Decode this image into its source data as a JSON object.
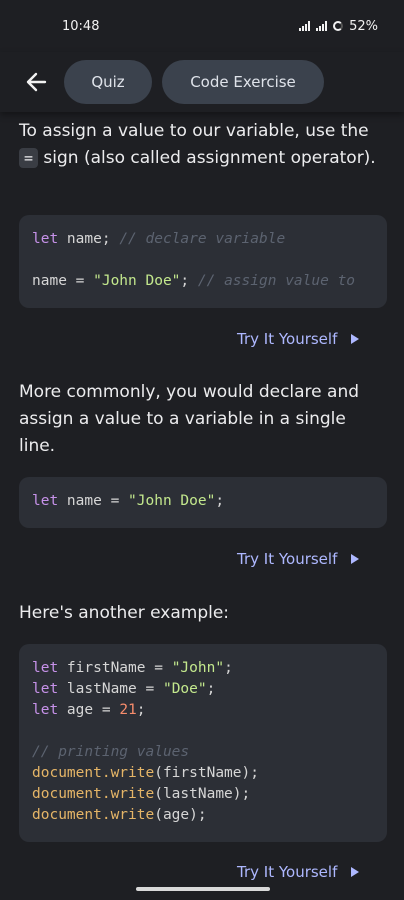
{
  "status_bar": {
    "time": "10:48",
    "battery": "52%"
  },
  "nav": {
    "quiz_label": "Quiz",
    "code_exercise_label": "Code Exercise"
  },
  "section1": {
    "text_before": "To assign a value to our variable, use the ",
    "inline_code": "=",
    "text_after": " sign (also called assignment operator)."
  },
  "code1": {
    "line1": {
      "kw": "let",
      "rest": " name; ",
      "comment": "// declare variable"
    },
    "line3": {
      "ident": "name = ",
      "str": "\"John Doe\"",
      "punct": "; ",
      "comment": "// assign value to"
    }
  },
  "try_label": "Try It Yourself",
  "section2": {
    "text": "More commonly, you would declare and assign a value to a variable in a single line."
  },
  "code2": {
    "kw": "let",
    "ident": " name = ",
    "str": "\"John Doe\"",
    "punct": ";"
  },
  "section3": {
    "text": "Here's another example:"
  },
  "code3": {
    "l1": {
      "kw": "let",
      "ident": " firstName = ",
      "str": "\"John\"",
      "punct": ";"
    },
    "l2": {
      "kw": "let",
      "ident": " lastName = ",
      "str": "\"Doe\"",
      "punct": ";"
    },
    "l3": {
      "kw": "let",
      "ident": " age = ",
      "num": "21",
      "punct": ";"
    },
    "l5": {
      "comment": "// printing values"
    },
    "l6": {
      "fn": "document.write",
      "args": "(firstName);"
    },
    "l7": {
      "fn": "document.write",
      "args": "(lastName);"
    },
    "l8": {
      "fn": "document.write",
      "args": "(age);"
    }
  },
  "icons": {
    "back": "arrow-left-icon",
    "play": "play-triangle-icon"
  }
}
